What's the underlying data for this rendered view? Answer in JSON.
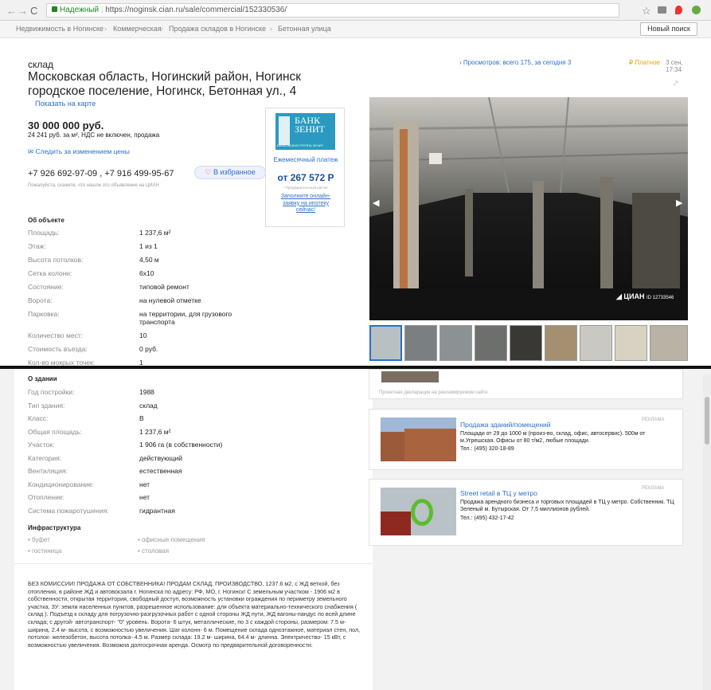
{
  "browser": {
    "secure": "Надежный",
    "url": "https://noginsk.cian.ru/sale/commercial/152330536/"
  },
  "breadcrumbs": [
    "Недвижимость в Ногинске",
    "Коммерческая",
    "Продажа складов в Ногинске",
    "Бетонная улица"
  ],
  "new_search": "Новый поиск",
  "listing": {
    "type": "склад",
    "address_line1": "Московская область, Ногинский район, Ногинск",
    "address_line2": "городское поселение, Ногинск, Бетонная ул., 4",
    "show_map": "Показать на карте",
    "views": "Просмотров: всего 175, за сегодня 3",
    "paid": "Платное",
    "date": "3 сен, 17:34",
    "price": "30 000 000 руб.",
    "price_sub": "24 241 руб. за м², НДС не включен, продажа",
    "follow": "Следить за изменением цены",
    "phones": "+7 926 692-97-09 , +7 916 499-95-67",
    "favorite": "В избранное",
    "note": "Пожалуйста, скажите, что нашли это объявление на ЦИАН"
  },
  "bank": {
    "name1": "БАНК",
    "name2": "ЗЕНИТ",
    "group": "БАНКОВСКАЯ ГРУППА ЗЕНИТ",
    "monthly": "Ежемесячный платеж",
    "amount": "от 267 572 Р",
    "calc": "* Предварительный расчет",
    "cta": "Заполните онлайн-заявку на ипотеку сейчас!"
  },
  "photo": {
    "watermark": "ЦИАН",
    "id": "ID 12733546"
  },
  "about_object": {
    "title": "Об объекте",
    "rows": [
      {
        "k": "Площадь:",
        "v": "1 237,6 м²"
      },
      {
        "k": "Этаж:",
        "v": "1 из 1"
      },
      {
        "k": "Высота потолков:",
        "v": "4,50 м"
      },
      {
        "k": "Сетка колонн:",
        "v": "6х10"
      },
      {
        "k": "Состояние:",
        "v": "типовой ремонт"
      },
      {
        "k": "Ворота:",
        "v": "на нулевой отметке"
      },
      {
        "k": "Парковка:",
        "v": "на территории, для грузового транспорта"
      },
      {
        "k": "Количество мест:",
        "v": "10"
      },
      {
        "k": "Стоимость въезда:",
        "v": "0 руб."
      },
      {
        "k": "Кол-во мокрых точек:",
        "v": "1"
      }
    ]
  },
  "about_building": {
    "title": "О здании",
    "rows": [
      {
        "k": "Год постройки:",
        "v": "1988"
      },
      {
        "k": "Тип здания:",
        "v": "склад"
      },
      {
        "k": "Класс:",
        "v": "B"
      },
      {
        "k": "Общая площадь:",
        "v": "1 237,6 м²"
      },
      {
        "k": "Участок:",
        "v": "1 906 га (в собственности)"
      },
      {
        "k": "Категория:",
        "v": "действующий"
      },
      {
        "k": "Вентиляция:",
        "v": "естественная"
      },
      {
        "k": "Кондиционирование:",
        "v": "нет"
      },
      {
        "k": "Отопление:",
        "v": "нет"
      },
      {
        "k": "Система пожаротушения:",
        "v": "гидрантная"
      }
    ]
  },
  "infrastructure": {
    "title": "Инфраструктура",
    "items": [
      "буфет",
      "офисные помещения",
      "гостиница",
      "столовая"
    ]
  },
  "description": "БЕЗ КОМИССИИ! ПРОДАЖА ОТ СОБСТВЕННИКА! ПРОДАМ СКЛАД, ПРОИЗВОДСТВО, 1237.6 м2, с ЖД веткой, без отопления, в районе ЖД и автовокзала г. Ногинска по адресу: РФ, МО, г. Ногинск! С земельным участком - 1906 м2 в собственности, открытая территория, свободный доступ, возможность установки ограждения по периметру земельного участка, ЗУ: земли населенных пунктов, разрешенное использование: для объекта материально-технического снабжения ( склад ). Подъезд к складу для погрузочно-разгрузочных работ с одной стороны ЖД пути, ЖД вагоны-пандус по всей длине склада; с другой- автотранспорт- \"0\" уровень. Ворота- 6 штук, металлические, по 3 с каждой стороны, размером: 7.5 м- ширина, 2.4 м- высота, с возможностью увеличения. Шаг колонн- 6 м. Помещение склада одноэтажное, материал стен, пол, потолок- железобетон, высота потолка- 4.5 м. Размер склада: 19.2 м- ширина, 64.4 м- длинна. Электричество- 15 кВт, с возможностью увеличения. Возможна долгосрочная аренда. Осмотр по предварительной договоренности.",
  "ads": {
    "disclaimer": "Проектная декларация на рекламируемом сайте",
    "ad1": {
      "tag": "РЕКЛАМА",
      "title": "Продажа зданий/помещений",
      "text": "Площади от 29 до 1000 м (произ-во, склад, офис, автосервис). 500м от м.Угрешская. Офисы от 80 т/м2, любые площади.",
      "phone": "Тел.: (495) 320-18-89"
    },
    "ad2": {
      "tag": "РЕКЛАМА",
      "title": "Street retail в ТЦ у метро",
      "text": "Продажа арендного бизнеса и торговых площадей в ТЦ у метро. Собственник. ТЦ Зеленый м. Бутырская. От 7,5 миллионов рублей.",
      "phone": "Тел.: (495) 432-17-42"
    }
  },
  "colors": {
    "accent": "#2b6fc9",
    "price_blue": "#1a4fa0",
    "fav_heart": "#e0364a",
    "paid": "#e8a200"
  }
}
